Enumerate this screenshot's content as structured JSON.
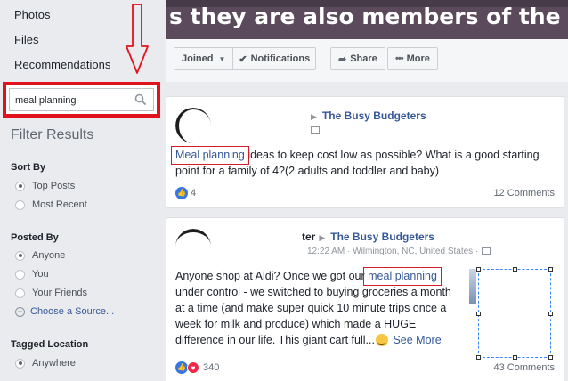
{
  "sidebar": {
    "links": [
      "Photos",
      "Files",
      "Recommendations"
    ],
    "search": {
      "value": "meal planning"
    },
    "filter_title": "Filter Results",
    "sort_by": {
      "heading": "Sort By",
      "options": [
        "Top Posts",
        "Most Recent"
      ],
      "selected": "Top Posts"
    },
    "posted_by": {
      "heading": "Posted By",
      "options": [
        "Anyone",
        "You",
        "Your Friends"
      ],
      "selected": "Anyone",
      "choose_source": "Choose a Source..."
    },
    "tagged_location": {
      "heading": "Tagged Location",
      "options": [
        "Anywhere"
      ],
      "selected": "Anywhere"
    }
  },
  "cover": {
    "text": "s they are also members of the group)"
  },
  "action_bar": {
    "joined": "Joined",
    "notifications": "Notifications",
    "share": "Share",
    "more": "More"
  },
  "posts": [
    {
      "author_fragment": "",
      "group": "The Busy Budgeters",
      "highlight": "Meal planning",
      "text_after": " ideas to keep cost low as possible? What is a good starting point for a family of 4?(2 adults and toddler and baby)",
      "reactions": "4",
      "comments": "12 Comments"
    },
    {
      "author_fragment": "ter",
      "group": "The Busy Budgeters",
      "meta": "12:22 AM · Wilmington, NC, United States ·",
      "text_before": "Anyone shop at Aldi? Once we got our ",
      "highlight": "meal planning",
      "text_after": " under control - we switched to buying groceries a month at a time (and make super quick 10 minute trips once a week for milk and produce) which made a HUGE difference in our life. This giant cart full...",
      "see_more": "See More",
      "reactions": "340",
      "comments": "43 Comments"
    }
  ],
  "colors": {
    "annotation": "#e0131c",
    "link": "#365899",
    "cover": "#5a4a5c"
  },
  "icons": [
    "search-icon",
    "check-icon",
    "share-icon",
    "more-dots-icon",
    "like-icon",
    "love-icon",
    "smile-emoji-icon",
    "globe-icon",
    "down-arrow-annotation"
  ]
}
